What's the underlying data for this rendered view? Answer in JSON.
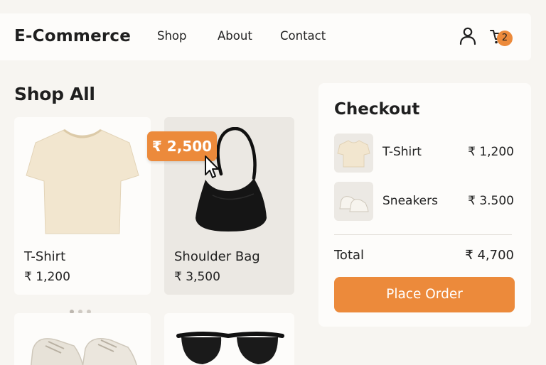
{
  "nav": {
    "brand": "E-Commerce",
    "links": [
      "Shop",
      "About",
      "Contact"
    ],
    "cart_count": "2",
    "icons": [
      "user-icon",
      "cart-icon"
    ]
  },
  "shop": {
    "title": "Shop All",
    "products": [
      {
        "name": "T-Shirt",
        "price": "₹ 1,200"
      },
      {
        "name": "Shoulder Bag",
        "price": "₹ 3,500"
      }
    ],
    "hover_price": "₹ 2,500",
    "carousel": {
      "dots": 3,
      "active": 0
    }
  },
  "checkout": {
    "title": "Checkout",
    "items": [
      {
        "name": "T-Shirt",
        "price": "₹ 1,200"
      },
      {
        "name": "Sneakers",
        "price": "₹ 3.500"
      }
    ],
    "total_label": "Total",
    "total_value": "₹ 4,700",
    "button": "Place Order"
  },
  "colors": {
    "accent": "#ec8a3b",
    "background": "#f7f5f1",
    "card": "#fdfcfa",
    "card_hover": "#ebe8e3"
  }
}
